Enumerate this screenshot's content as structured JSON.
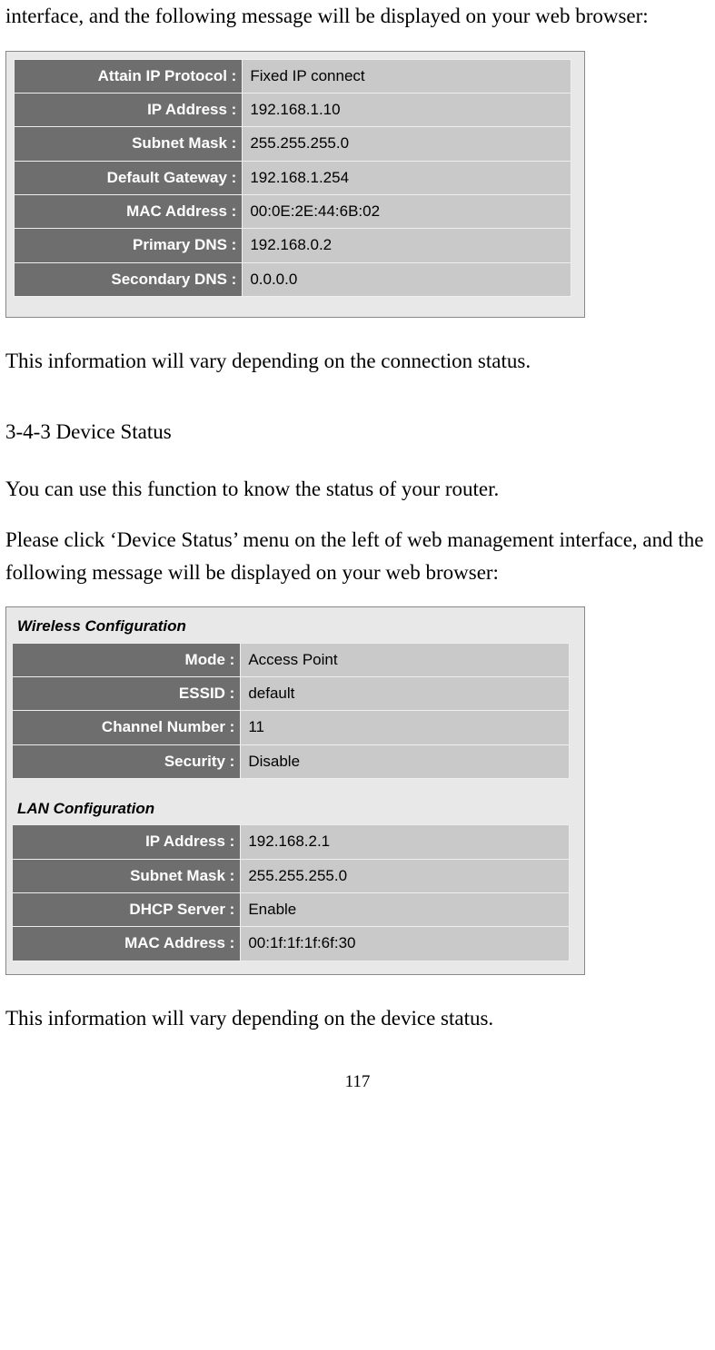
{
  "intro1": "interface, and the following message will be displayed on your web browser:",
  "table1": {
    "rows": [
      {
        "label": "Attain IP Protocol :",
        "value": "Fixed IP connect"
      },
      {
        "label": "IP Address :",
        "value": "192.168.1.10"
      },
      {
        "label": "Subnet Mask :",
        "value": "255.255.255.0"
      },
      {
        "label": "Default Gateway :",
        "value": "192.168.1.254"
      },
      {
        "label": "MAC Address :",
        "value": "00:0E:2E:44:6B:02"
      },
      {
        "label": "Primary DNS :",
        "value": "192.168.0.2"
      },
      {
        "label": "Secondary DNS :",
        "value": "0.0.0.0"
      }
    ]
  },
  "note1": "This information will vary depending on the connection status.",
  "heading2": "3-4-3 Device Status",
  "para2a": "You can use this function to know the status of your router.",
  "para2b": "Please click ‘Device Status’ menu on the left of web management interface, and the following message will be displayed on your web browser:",
  "table2": {
    "section1_title": "Wireless Configuration",
    "section1_rows": [
      {
        "label": "Mode :",
        "value": "Access Point"
      },
      {
        "label": "ESSID :",
        "value": "default"
      },
      {
        "label": "Channel Number :",
        "value": "11"
      },
      {
        "label": "Security :",
        "value": "Disable"
      }
    ],
    "section2_title": "LAN Configuration",
    "section2_rows": [
      {
        "label": "IP Address :",
        "value": "192.168.2.1"
      },
      {
        "label": "Subnet Mask :",
        "value": "255.255.255.0"
      },
      {
        "label": "DHCP Server :",
        "value": "Enable"
      },
      {
        "label": "MAC Address :",
        "value": "00:1f:1f:1f:6f:30"
      }
    ]
  },
  "note2": "This information will vary depending on the device status.",
  "page_number": "117"
}
